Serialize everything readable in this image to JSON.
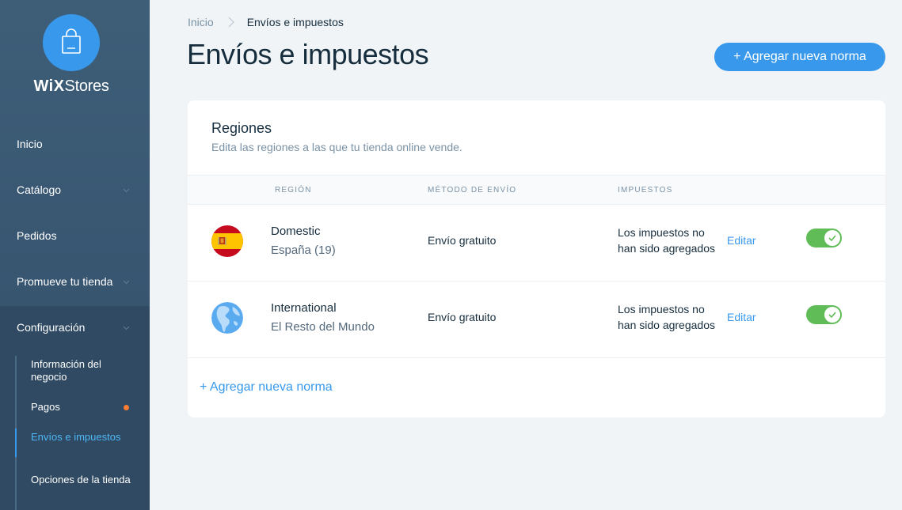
{
  "sidebar": {
    "logo": {
      "brand_bold": "WiX",
      "brand_light": "Stores",
      "icon": "shopping-bag-icon"
    },
    "nav": [
      {
        "label": "Inicio"
      },
      {
        "label": "Catálogo",
        "has_chevron": true
      },
      {
        "label": "Pedidos"
      },
      {
        "label": "Promueve tu tienda",
        "has_chevron": true
      },
      {
        "label": "Configuración",
        "has_chevron": true
      }
    ],
    "sub_items": [
      {
        "label": "Información del negocio"
      },
      {
        "label": "Pagos",
        "has_dot": true
      },
      {
        "label": "Envíos e impuestos",
        "active": true
      },
      {
        "label": "Opciones de la tienda"
      }
    ]
  },
  "breadcrumb": {
    "home": "Inicio",
    "current": "Envíos e impuestos"
  },
  "page": {
    "title": "Envíos e impuestos",
    "primary_button": "+ Agregar nueva norma"
  },
  "card": {
    "title": "Regiones",
    "subtitle": "Edita las regiones a las que tu tienda online vende.",
    "columns": [
      "REGIÓN",
      "MÉTODO DE ENVÍO",
      "IMPUESTOS"
    ],
    "rows": [
      {
        "flag_icon": "spain-flag-icon",
        "name": "Domestic",
        "count": "España (19)",
        "method": "Envío gratuito",
        "tax_line1": "Los impuestos no",
        "tax_line2": "han sido agregados",
        "edit": "Editar",
        "enabled": true
      },
      {
        "flag_icon": "globe-icon",
        "name": "International",
        "count": "El Resto del Mundo",
        "method": "Envío gratuito",
        "tax_line1": "Los impuestos no",
        "tax_line2": "han sido agregados",
        "edit": "Editar",
        "enabled": true
      }
    ],
    "add_link": "+ Agregar nueva norma"
  },
  "colors": {
    "accent": "#3899ec",
    "toggle_on": "#60bc57",
    "sidebar": "#3d5a73",
    "sidebar_active_section": "#2f4a62",
    "notification_dot": "#fb7d33"
  }
}
